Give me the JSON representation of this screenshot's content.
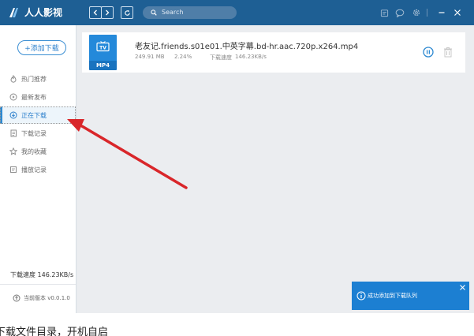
{
  "app": {
    "title": "人人影视"
  },
  "toolbar": {
    "back_icon": "chevron-left-icon",
    "forward_icon": "chevron-right-icon",
    "refresh_icon": "refresh-icon",
    "search_placeholder": "Search",
    "icons": [
      "folder-icon",
      "chat-icon",
      "settings-icon",
      "minimize-icon",
      "close-icon"
    ]
  },
  "sidebar": {
    "add_button_label": "+添加下载",
    "items": [
      {
        "label": "热门推荐",
        "icon": "flame-icon"
      },
      {
        "label": "最新发布",
        "icon": "play-circle-icon"
      },
      {
        "label": "正在下载",
        "icon": "download-icon",
        "active": true
      },
      {
        "label": "下载记录",
        "icon": "document-icon"
      },
      {
        "label": "我的收藏",
        "icon": "star-icon"
      },
      {
        "label": "播放记录",
        "icon": "history-icon"
      }
    ],
    "speed": "下载速度  146.23KB/s",
    "version": "当前版本 v0.0.1.0"
  },
  "download": {
    "file_name": "老友记.friends.s01e01.中英字幕.bd-hr.aac.720p.x264.mp4",
    "size": "249.91 MB",
    "progress": "2.24%",
    "progress_value": 2.24,
    "speed_label": "下载速度",
    "speed": "146.23KB/s",
    "thumb_label": "MP4",
    "thumb_icon": "tv-icon"
  },
  "toast": {
    "message": "成功添加到下载队列"
  },
  "caption": "下载文件目录，开机自启",
  "colors": {
    "titlebar": "#1e5f94",
    "accent": "#2d89d1",
    "toast": "#1c7fd2",
    "arrow": "#d9262a"
  }
}
